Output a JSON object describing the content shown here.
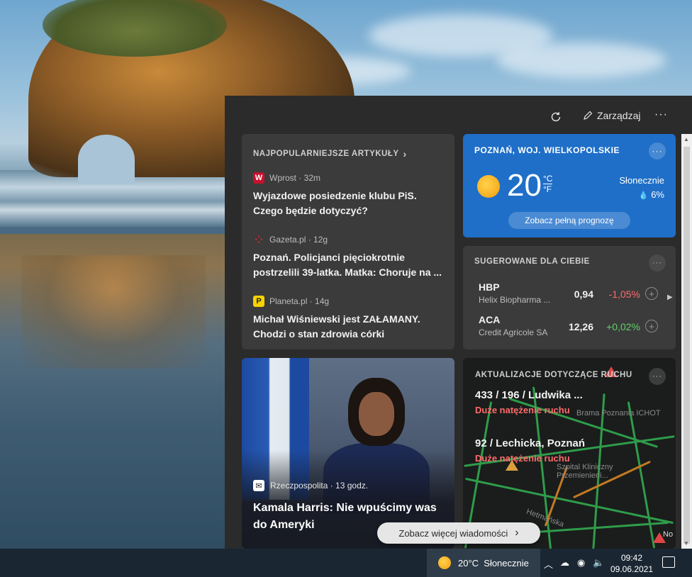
{
  "panel": {
    "header": {
      "manage_label": "Zarządzaj",
      "more_label": "···"
    },
    "top_stories": {
      "title": "NAJPOPULARNIEJSZE ARTYKUŁY",
      "chevron": "›",
      "items": [
        {
          "source": "Wprost · 32m",
          "logo": "W",
          "logo_color": "#c8102e",
          "title_line1": "Wyjazdowe posiedzenie klubu PiS.",
          "title_line2": "Czego będzie dotyczyć?"
        },
        {
          "source": "Gazeta.pl · 12g",
          "logo": "⁘",
          "logo_color": "#d6293a",
          "title_line1": "Poznań. Policjanci pięciokrotnie",
          "title_line2": "postrzelili 39-latka. Matka: Choruje na ..."
        },
        {
          "source": "Planeta.pl · 14g",
          "logo": "P",
          "logo_color": "#f5d300",
          "title_line1": "Michał Wiśniewski jest ZAŁAMANY.",
          "title_line2": "Chodzi o stan zdrowia córki"
        }
      ]
    },
    "weather": {
      "location": "POZNAŃ, WOJ. WIELKOPOLSKIE",
      "temp": "20",
      "unit_c": "°C",
      "unit_f": "°F",
      "condition": "Słonecznie",
      "precip": "6%",
      "forecast_label": "Zobacz pełną prognozę",
      "more_label": "···"
    },
    "stocks": {
      "title": "SUGEROWANE DLA CIEBIE",
      "more_label": "···",
      "items": [
        {
          "symbol": "HBP",
          "name": "Helix Biopharma ...",
          "price": "0,94",
          "change": "-1,05%",
          "direction": "neg"
        },
        {
          "symbol": "ACA",
          "name": "Credit Agricole SA",
          "price": "12,26",
          "change": "+0,02%",
          "direction": "pos"
        }
      ]
    },
    "photo_story": {
      "source": "Rzeczpospolita · 13 godz.",
      "title": "Kamala Harris: Nie wpuścimy was do Ameryki"
    },
    "traffic": {
      "title": "AKTUALIZACJE DOTYCZĄCE RUCHU",
      "more_label": "···",
      "items": [
        {
          "road": "433 / 196 / Ludwika ...",
          "status": "Duże natężenie ruchu"
        },
        {
          "road": "92 / Lechicka, Poznań",
          "status": "Duże natężenie ruchu"
        }
      ],
      "map_labels": {
        "brama": "Brama Poznania ICHOT",
        "szpital_1": "Szpital Kliniczny",
        "szpital_2": "Przemienieni...",
        "hetmanska": "Hetmańska",
        "no": "No"
      }
    },
    "see_more_label": "Zobacz więcej wiadomości",
    "see_more_chevron": "›"
  },
  "taskbar": {
    "weather_text": "20°C  Słonecznie",
    "time": "09:42",
    "date": "09.06.2021"
  }
}
